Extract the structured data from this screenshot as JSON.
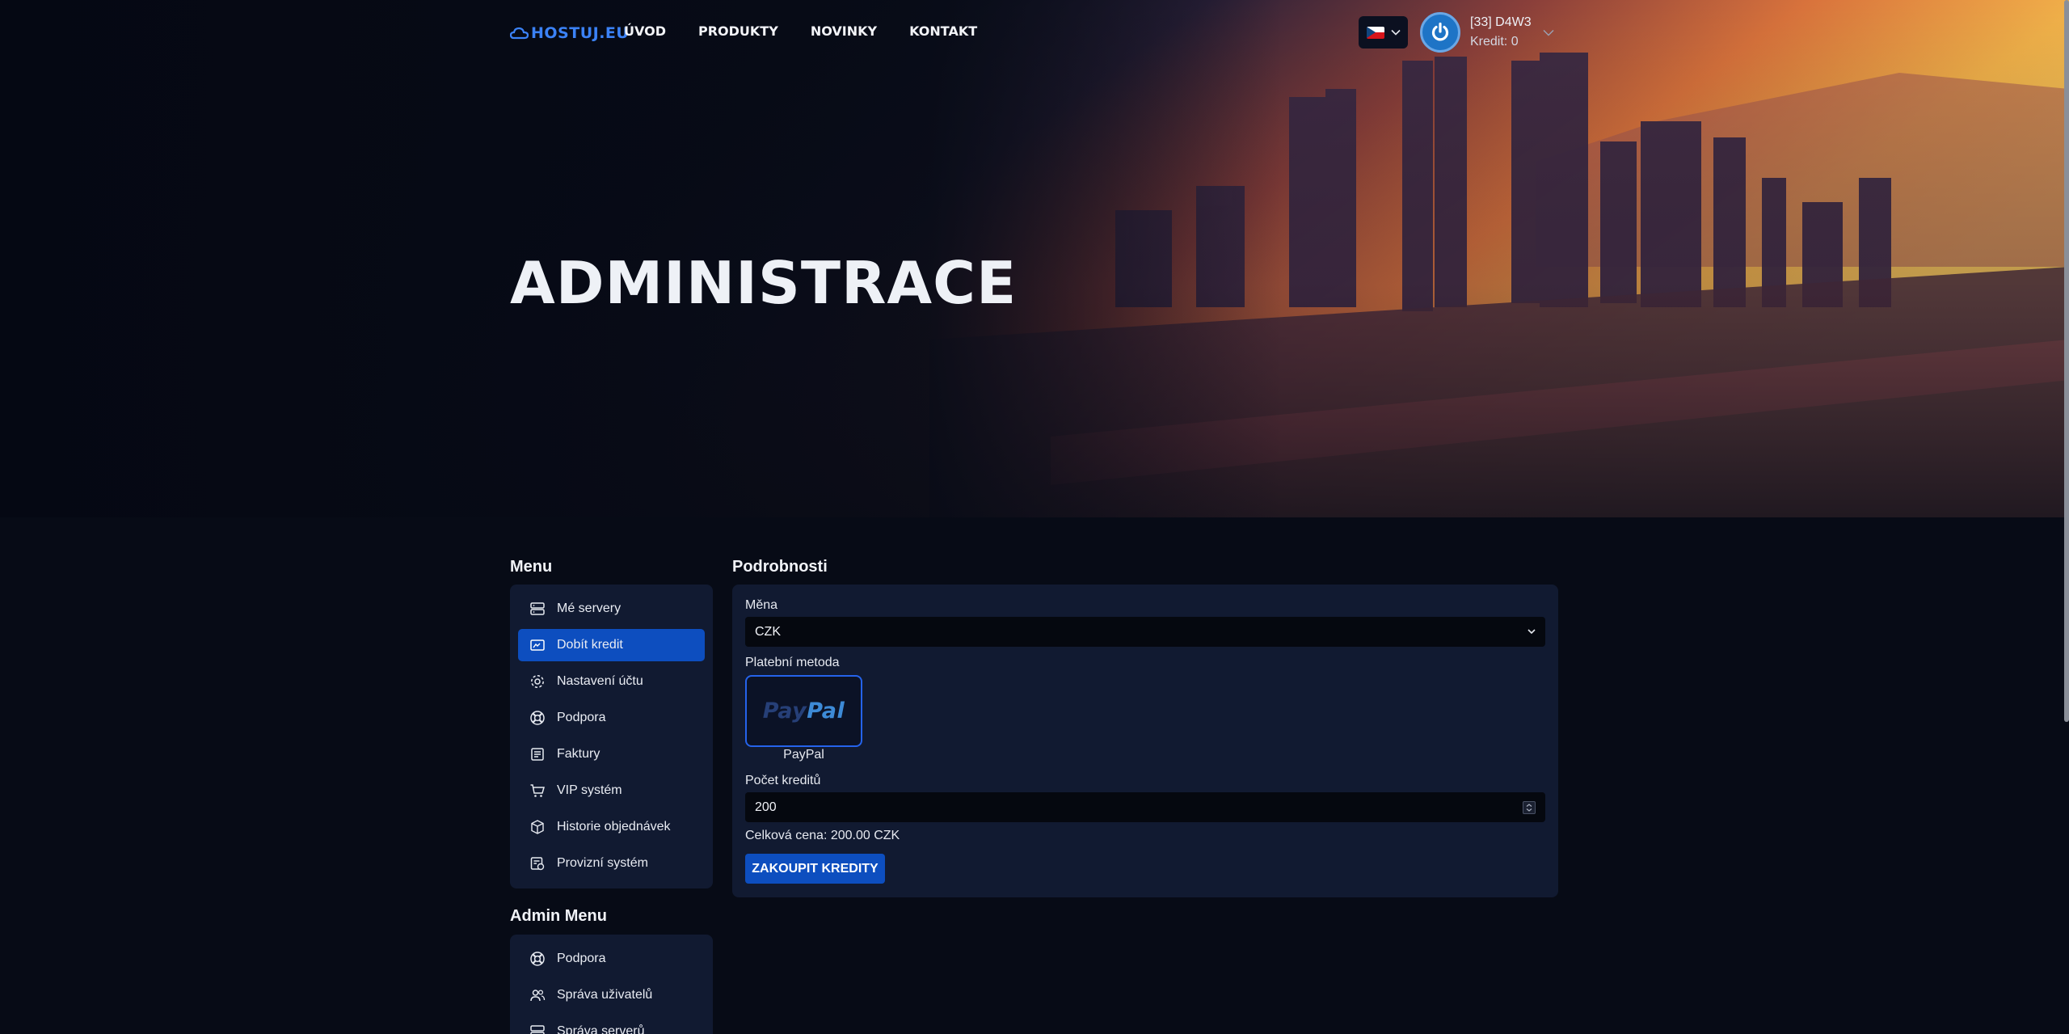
{
  "brand": {
    "logo_text": "HOSTUJ.EU"
  },
  "nav": {
    "items": [
      "ÚVOD",
      "PRODUKTY",
      "NOVINKY",
      "KONTAKT"
    ]
  },
  "user": {
    "name": "[33] D4W3",
    "credit": "Kredit: 0"
  },
  "hero": {
    "title": "ADMINISTRACE"
  },
  "menu": {
    "title": "Menu",
    "items": [
      {
        "label": "Mé servery",
        "icon": "server-icon"
      },
      {
        "label": "Dobít kredit",
        "icon": "credit-card-icon",
        "active": true
      },
      {
        "label": "Nastavení účtu",
        "icon": "gear-icon"
      },
      {
        "label": "Podpora",
        "icon": "lifebuoy-icon"
      },
      {
        "label": "Faktury",
        "icon": "invoice-icon"
      },
      {
        "label": "VIP systém",
        "icon": "cart-icon"
      },
      {
        "label": "Historie objednávek",
        "icon": "package-icon"
      },
      {
        "label": "Provizní systém",
        "icon": "commission-icon"
      }
    ]
  },
  "admin_menu": {
    "title": "Admin Menu",
    "items": [
      {
        "label": "Podpora",
        "icon": "lifebuoy-icon"
      },
      {
        "label": "Správa uživatelů",
        "icon": "users-icon"
      },
      {
        "label": "Správa serverů",
        "icon": "server-icon"
      }
    ]
  },
  "details": {
    "title": "Podrobnosti",
    "currency_label": "Měna",
    "currency_value": "CZK",
    "payment_label": "Platební metoda",
    "payment_logo": "PayPal",
    "payment_name": "PayPal",
    "credits_label": "Počet kreditů",
    "credits_value": "200",
    "total": "Celková cena: 200.00 CZK",
    "buy_label": "ZAKOUPIT KREDITY"
  },
  "colors": {
    "accent": "#0d4ebf",
    "card": "#111a31",
    "page": "#070b16"
  }
}
